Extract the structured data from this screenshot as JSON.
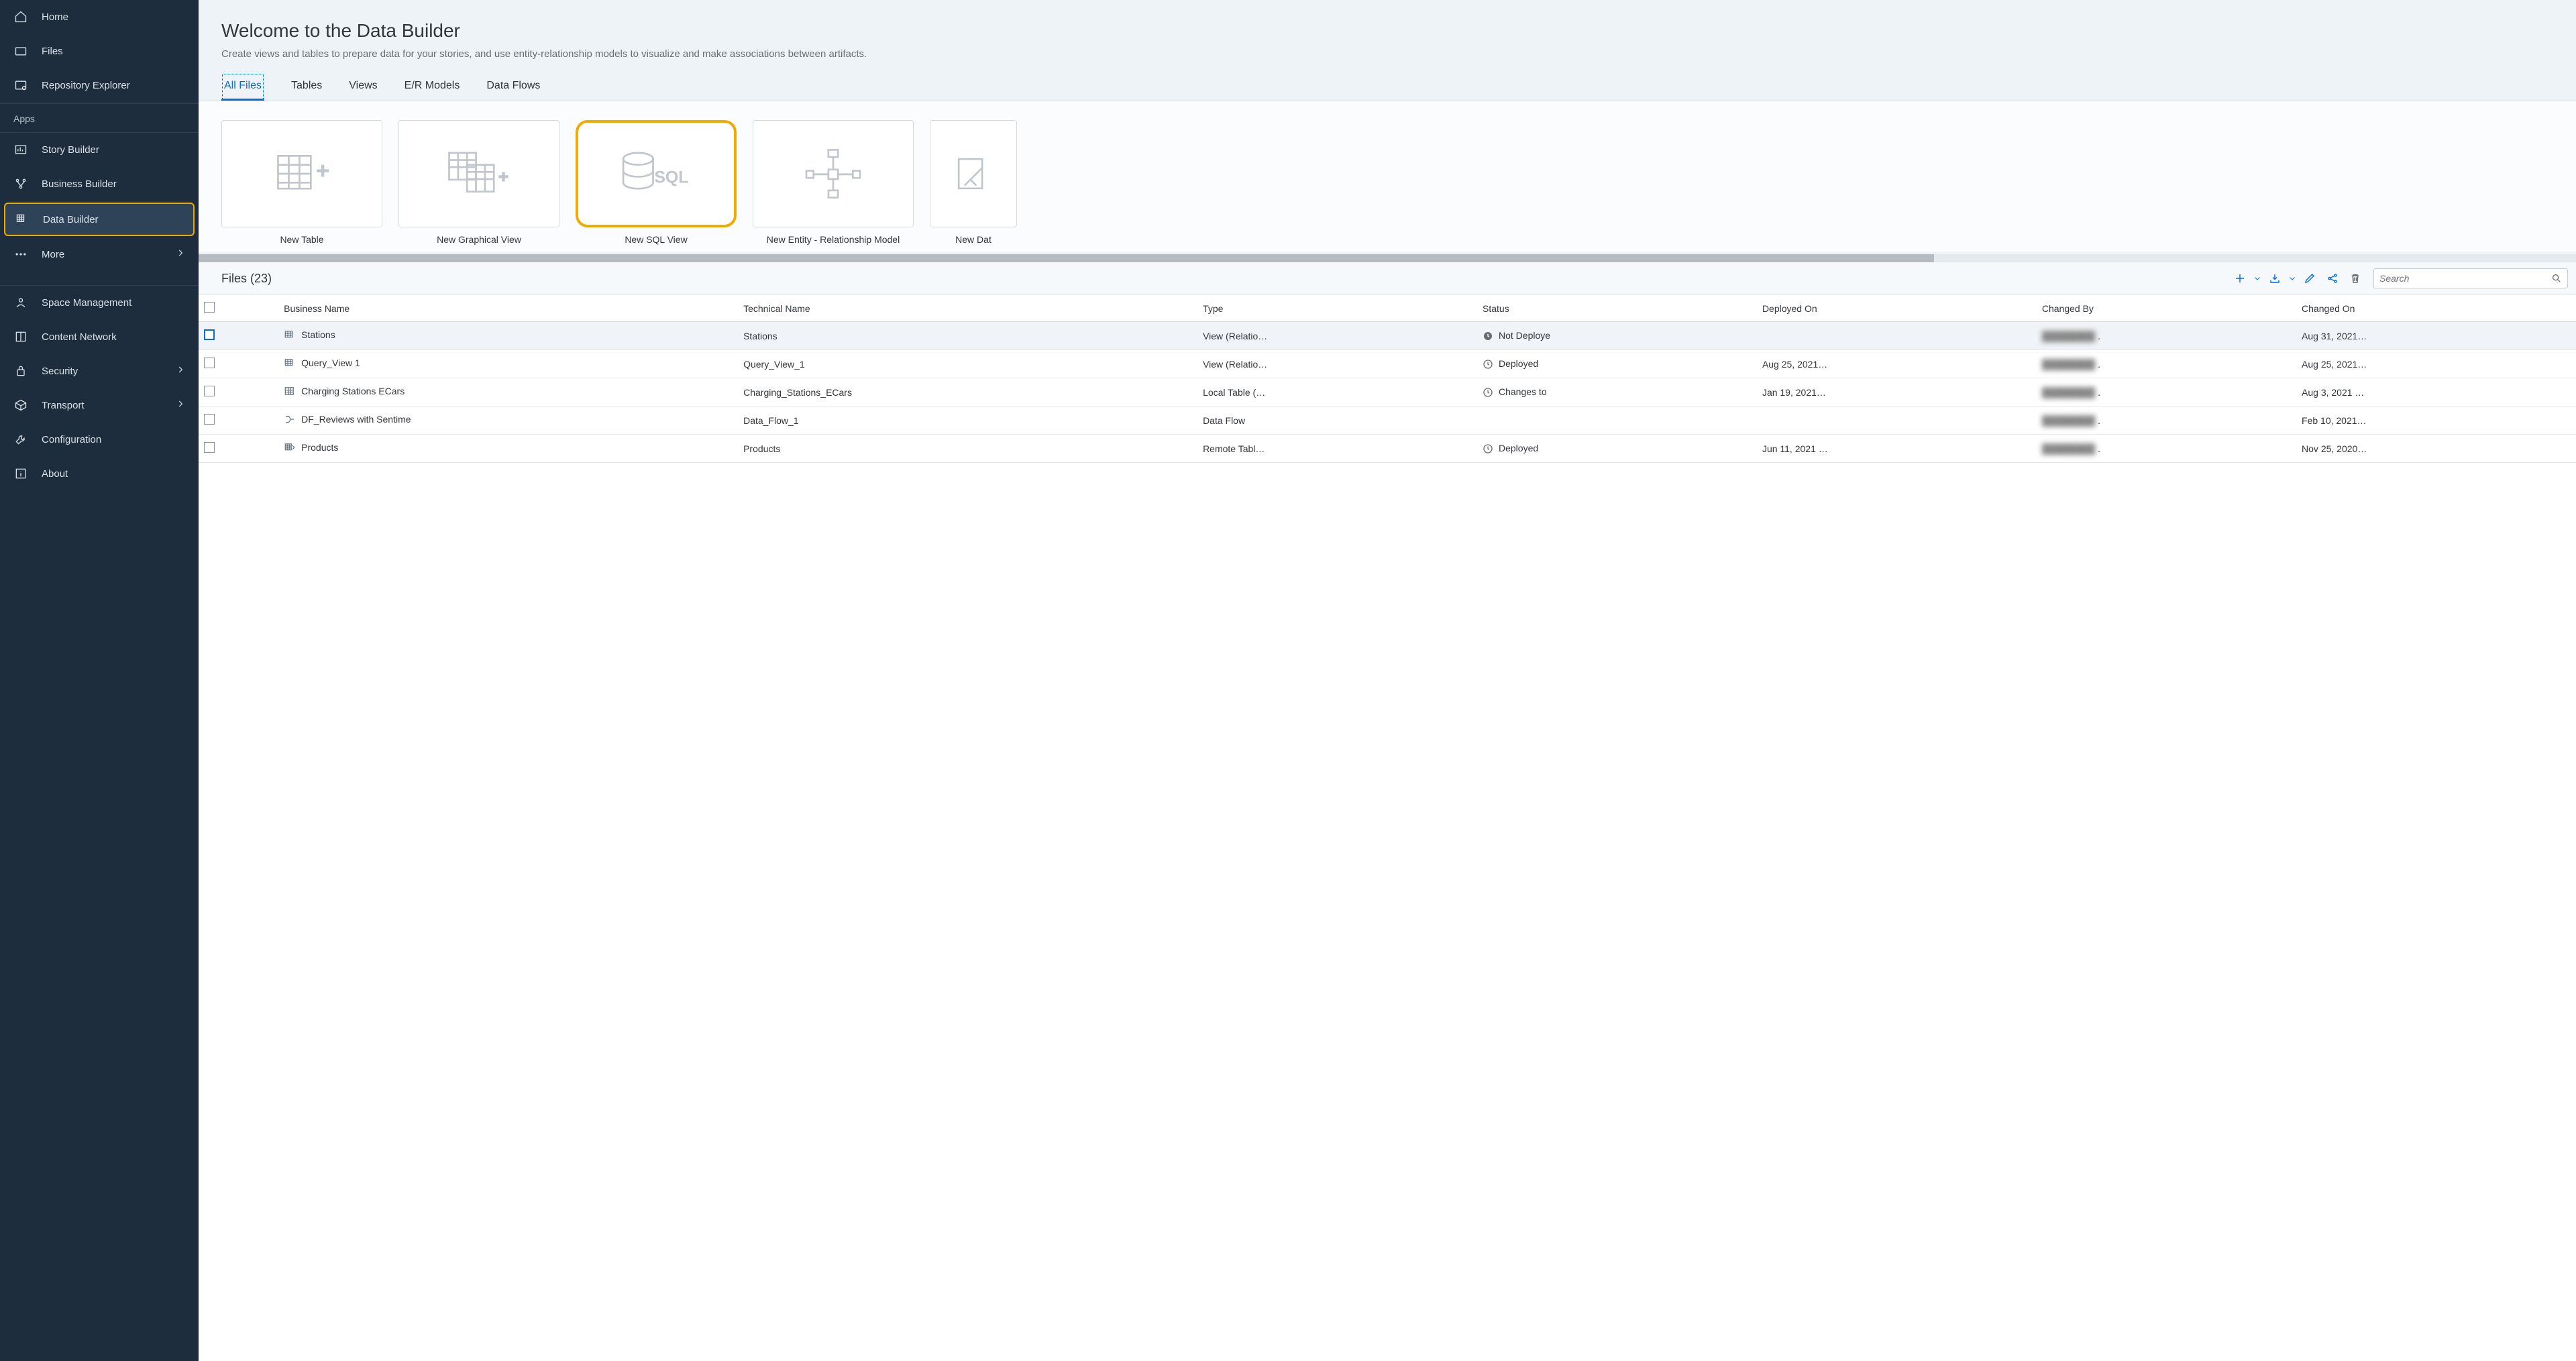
{
  "sidebar": {
    "home": "Home",
    "files": "Files",
    "repo": "Repository Explorer",
    "apps_label": "Apps",
    "story": "Story Builder",
    "business": "Business Builder",
    "data": "Data Builder",
    "more": "More",
    "space": "Space Management",
    "content": "Content Network",
    "security": "Security",
    "transport": "Transport",
    "config": "Configuration",
    "about": "About"
  },
  "header": {
    "title": "Welcome to the Data Builder",
    "subtitle": "Create views and tables to prepare data for your stories, and use entity-relationship models to visualize and make associations between artifacts."
  },
  "tabs": {
    "all": "All Files",
    "tables": "Tables",
    "views": "Views",
    "er": "E/R Models",
    "flows": "Data Flows"
  },
  "cards": {
    "new_table": "New Table",
    "new_graph": "New Graphical View",
    "new_sql": "New SQL View",
    "new_er": "New Entity - Relationship Model",
    "new_data": "New Dat"
  },
  "files_bar": {
    "title": "Files (23)",
    "search_placeholder": "Search"
  },
  "table": {
    "headers": {
      "business": "Business Name",
      "technical": "Technical Name",
      "type": "Type",
      "status": "Status",
      "deployed": "Deployed On",
      "changed_by": "Changed By",
      "changed_on": "Changed On"
    },
    "rows": [
      {
        "bn": "Stations",
        "tn": "Stations",
        "type": "View (Relatio…",
        "status": "Not Deploye",
        "status_icon": "clock-solid",
        "deployed": "",
        "changed_by": "████████",
        "changed_on": "Aug 31, 2021…"
      },
      {
        "bn": "Query_View 1",
        "tn": "Query_View_1",
        "type": "View (Relatio…",
        "status": "Deployed",
        "status_icon": "clock",
        "deployed": "Aug 25, 2021…",
        "changed_by": "████████",
        "changed_on": "Aug 25, 2021…"
      },
      {
        "bn": "Charging Stations ECars",
        "tn": "Charging_Stations_ECars",
        "type": "Local Table (…",
        "status": "Changes to",
        "status_icon": "clock",
        "deployed": "Jan 19, 2021…",
        "changed_by": "████████",
        "changed_on": "Aug 3, 2021 …"
      },
      {
        "bn": "DF_Reviews with Sentime",
        "tn": "Data_Flow_1",
        "type": "Data Flow",
        "status": "",
        "status_icon": "",
        "deployed": "",
        "changed_by": "████████",
        "changed_on": "Feb 10, 2021…"
      },
      {
        "bn": "Products",
        "tn": "Products",
        "type": "Remote Tabl…",
        "status": "Deployed",
        "status_icon": "clock",
        "deployed": "Jun 11, 2021 …",
        "changed_by": "████████",
        "changed_on": "Nov 25, 2020…"
      }
    ]
  }
}
